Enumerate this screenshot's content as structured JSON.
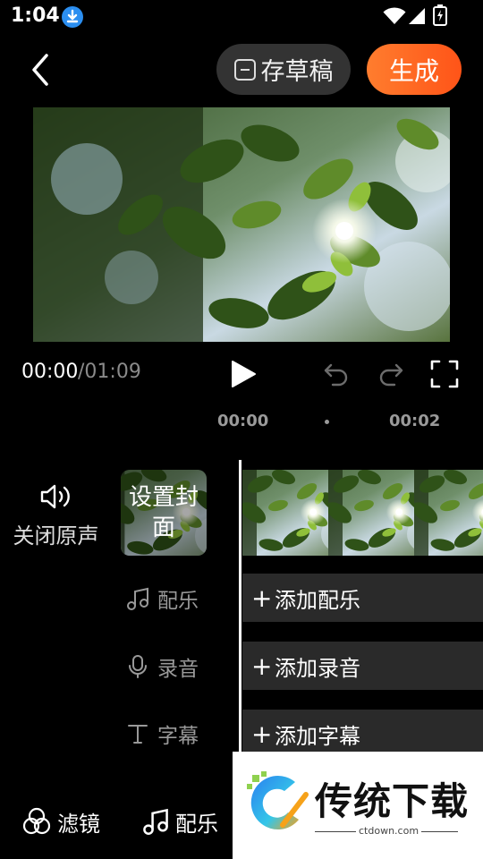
{
  "status_bar": {
    "time": "1:04"
  },
  "header": {
    "draft_label": "存草稿",
    "generate_label": "生成"
  },
  "playback": {
    "current_time": "00:00",
    "total_time": "/01:09"
  },
  "ruler": {
    "tick_0": "00:00",
    "tick_1": "00:02"
  },
  "left_panel": {
    "mute_label": "关闭原声",
    "cover_label": "设置封面"
  },
  "tracks": [
    {
      "label": "配乐",
      "add_label": "添加配乐"
    },
    {
      "label": "录音",
      "add_label": "添加录音"
    },
    {
      "label": "字幕",
      "add_label": "添加字幕"
    }
  ],
  "toolbar": [
    {
      "label": "滤镜"
    },
    {
      "label": "配乐"
    }
  ],
  "watermark": {
    "brand": "传统下载",
    "url": "ctdown.com"
  },
  "colors": {
    "accent": "#ff5e1f",
    "draft_bg": "#333333",
    "track_bg": "#2a2a2a",
    "download_badge": "#2b8ef0"
  }
}
